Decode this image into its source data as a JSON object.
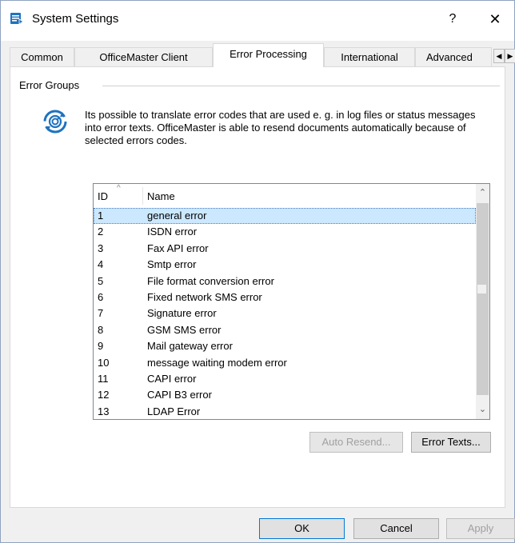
{
  "window": {
    "title": "System Settings",
    "help_label": "?",
    "close_label": "✕"
  },
  "tabs": [
    {
      "label": "Common"
    },
    {
      "label": "OfficeMaster Client"
    },
    {
      "label": "Error Processing"
    },
    {
      "label": "International"
    },
    {
      "label": "Advanced"
    }
  ],
  "active_tab": "Error Processing",
  "tab_scroll": {
    "left": "◀",
    "right": "▶"
  },
  "group": {
    "label": "Error Groups",
    "description": "Its possible to translate error codes that are used e. g. in log files or status messages into error texts. OfficeMaster is able to resend documents automatically because of selected errors codes."
  },
  "list": {
    "columns": {
      "id": "ID",
      "name": "Name"
    },
    "sort_indicator": "^",
    "rows": [
      {
        "id": "1",
        "name": "general error"
      },
      {
        "id": "2",
        "name": "ISDN error"
      },
      {
        "id": "3",
        "name": "Fax API error"
      },
      {
        "id": "4",
        "name": "Smtp error"
      },
      {
        "id": "5",
        "name": "File format conversion error"
      },
      {
        "id": "6",
        "name": "Fixed network SMS error"
      },
      {
        "id": "7",
        "name": "Signature error"
      },
      {
        "id": "8",
        "name": "GSM SMS error"
      },
      {
        "id": "9",
        "name": "Mail gateway error"
      },
      {
        "id": "10",
        "name": "message waiting modem error"
      },
      {
        "id": "11",
        "name": "CAPI error"
      },
      {
        "id": "12",
        "name": "CAPI B3 error"
      },
      {
        "id": "13",
        "name": "LDAP Error"
      }
    ],
    "selected_id": "1",
    "scroll_up": "⌃",
    "scroll_down": "⌄"
  },
  "buttons": {
    "auto_resend": "Auto Resend...",
    "error_texts": "Error Texts...",
    "ok": "OK",
    "cancel": "Cancel",
    "apply": "Apply"
  },
  "colors": {
    "selection": "#cce8ff",
    "accent": "#0078d7",
    "icon_blue": "#1e73be"
  }
}
